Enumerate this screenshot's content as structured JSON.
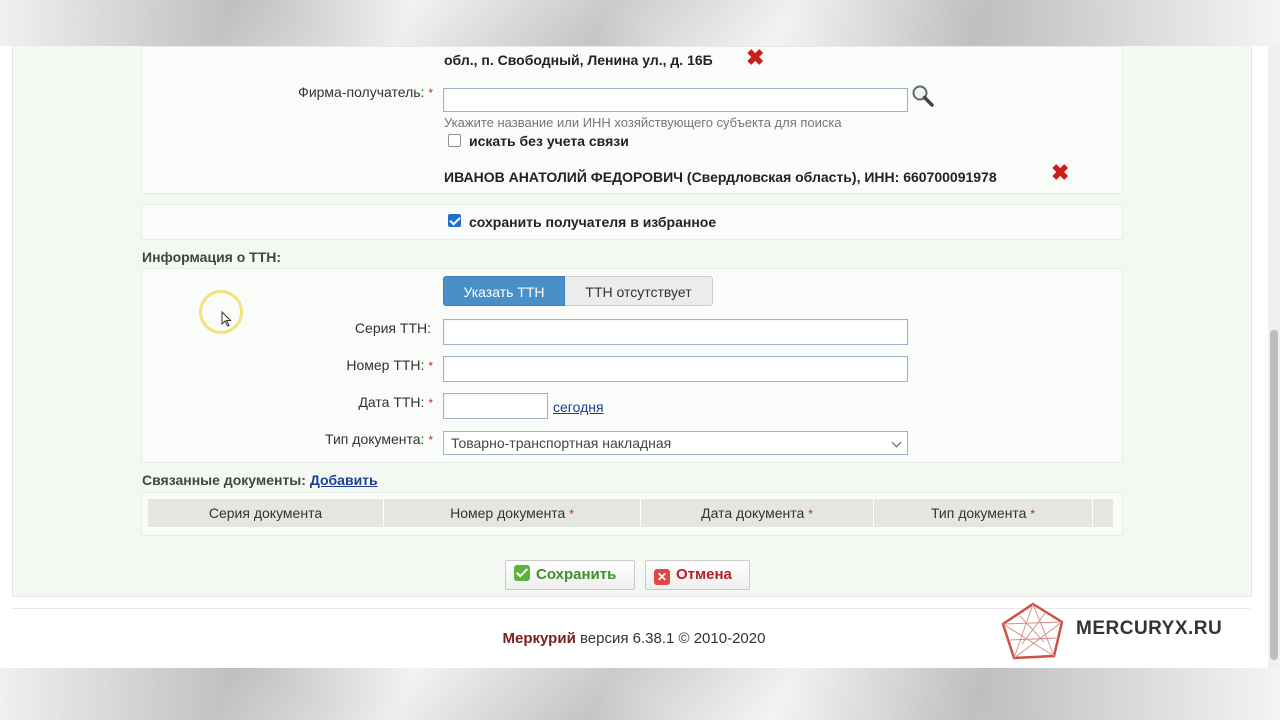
{
  "address_tail": "обл., п. Свободный, Ленина ул., д. 16Б",
  "recipient": {
    "label": "Фирма-получатель:",
    "required": "*",
    "input_value": "",
    "hint": "Укажите название или ИНН хозяйствующего субъекта для поиска",
    "no_link_label": "искать без учета связи",
    "selected": "ИВАНОВ АНАТОЛИЙ ФЕДОРОВИЧ",
    "selected_detail": "(Свердловская область), ИНН: 660700091978"
  },
  "favorite": {
    "label": "сохранить получателя в избранное",
    "checked": true
  },
  "ttn": {
    "section_title": "Информация о ТТН:",
    "tabs": [
      "Указать ТТН",
      "ТТН отсутствует"
    ],
    "series_label": "Серия ТТН:",
    "series_value": "",
    "number_label": "Номер ТТН:",
    "number_value": "",
    "date_label": "Дата ТТН:",
    "date_value": "",
    "today_link": "сегодня",
    "doctype_label": "Тип документа:",
    "doctype_value": "Товарно-транспортная накладная",
    "required": "*"
  },
  "related": {
    "title": "Связанные документы:",
    "add_link": "Добавить",
    "columns": [
      "Серия документа",
      "Номер документа",
      "Дата документа",
      "Тип документа"
    ],
    "required": "*"
  },
  "actions": {
    "save": "Сохранить",
    "cancel": "Отмена"
  },
  "footer": {
    "brand": "Меркурий",
    "text": "версия 6.38.1 © 2010-2020"
  },
  "watermark": "MERCURYX.RU",
  "colors": {
    "accent": "#4a90c8",
    "required": "#c0262d",
    "link": "#1c3f94",
    "brand": "#7a1e1e"
  }
}
